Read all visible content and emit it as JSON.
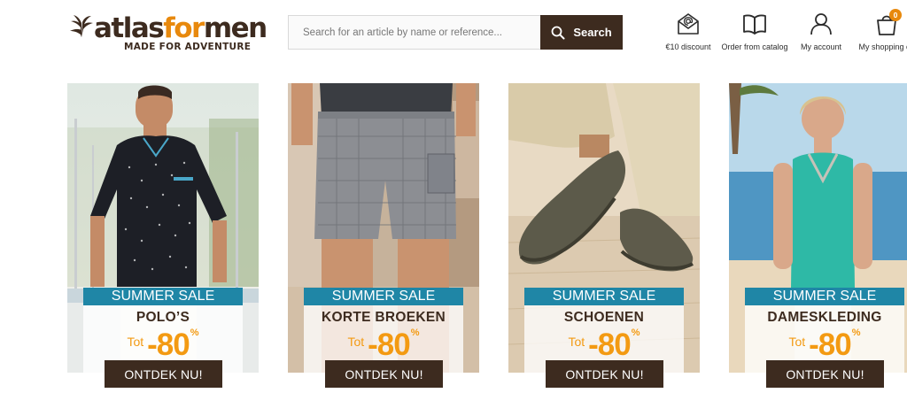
{
  "brand": {
    "name_part1": "atlas",
    "name_part2": "for",
    "name_part3": "men",
    "tagline": "MADE FOR ADVENTURE",
    "color_primary": "#3d2b1f",
    "color_accent": "#e8890d"
  },
  "search": {
    "placeholder": "Search for an article by name or reference...",
    "value": "",
    "button_label": "Search",
    "icon": "search-icon"
  },
  "header_links": [
    {
      "label": "€10 discount",
      "icon": "email-at-icon"
    },
    {
      "label": "Order from catalog",
      "icon": "open-book-icon"
    },
    {
      "label": "My account",
      "icon": "user-icon"
    },
    {
      "label": "My shopping ca",
      "icon": "shopping-bag-icon",
      "badge": "0"
    }
  ],
  "promo": {
    "sale_label": "SUMMER SALE",
    "prefix": "Tot",
    "discount": "-80",
    "percent": "%",
    "cta_label": "ONTDEK NU!",
    "band_color": "#1f86a6",
    "discount_color": "#f39a12"
  },
  "categories": [
    {
      "name": "POLO’S"
    },
    {
      "name": "KORTE BROEKEN"
    },
    {
      "name": "SCHOENEN"
    },
    {
      "name": "DAMESKLEDING"
    }
  ]
}
